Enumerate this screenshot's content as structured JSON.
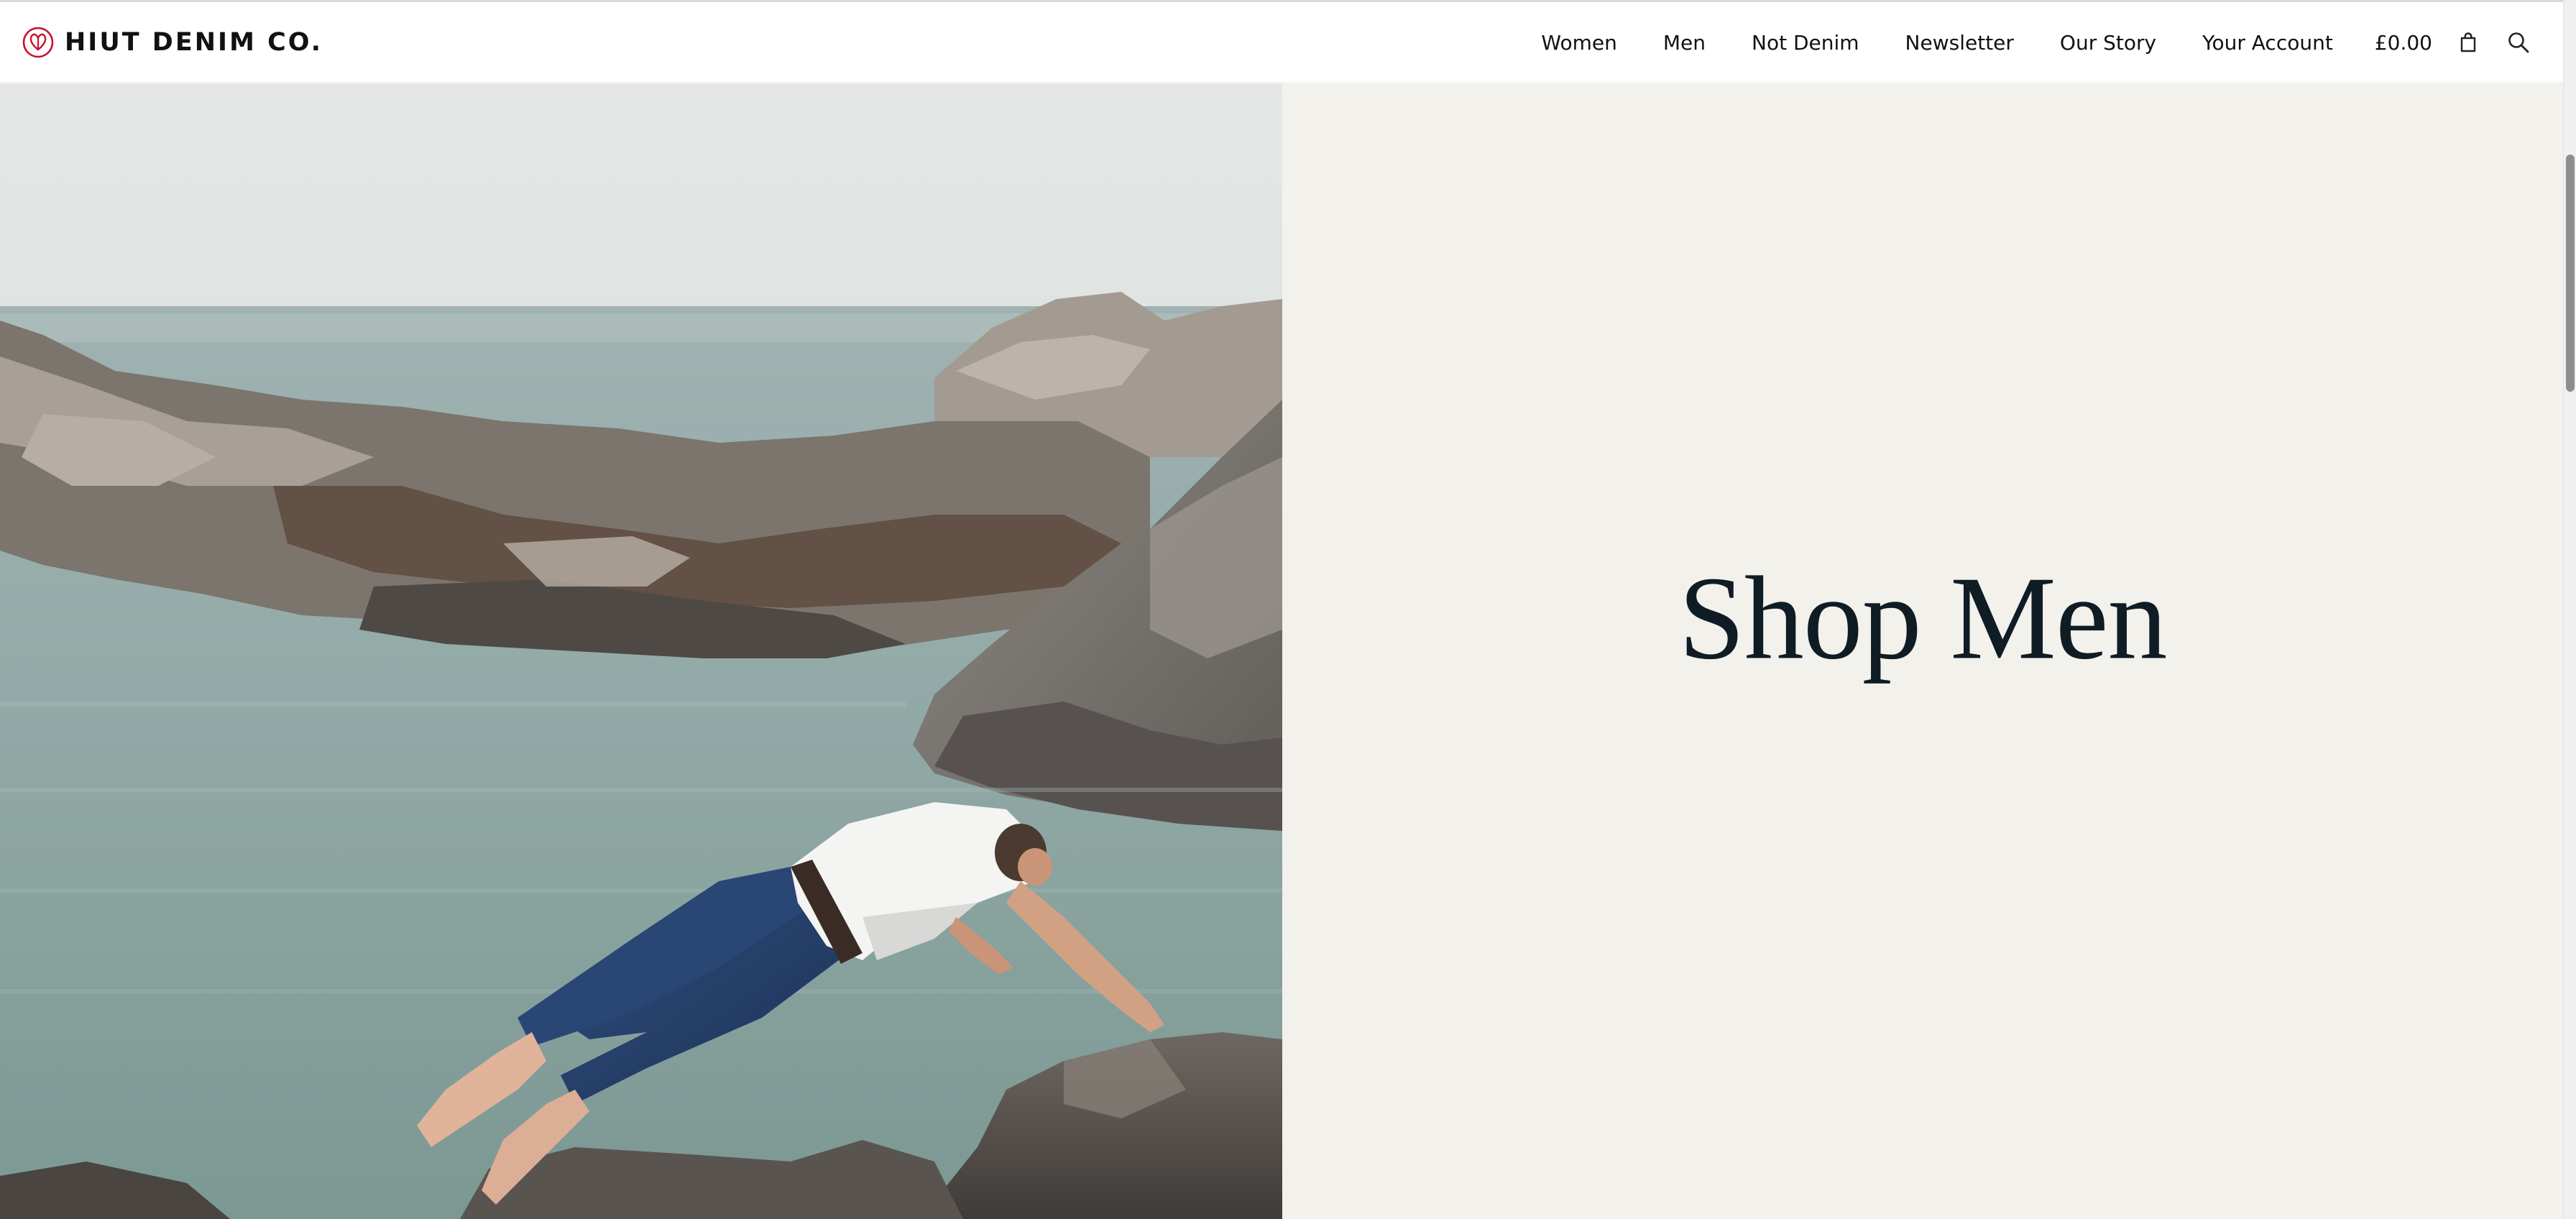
{
  "brand": {
    "name": "HIUT DENIM CO.",
    "accent_color": "#c8102e",
    "logo_icon": "leaf-heart-logo-icon"
  },
  "nav": {
    "items": [
      {
        "label": "Women"
      },
      {
        "label": "Men"
      },
      {
        "label": "Not Denim"
      },
      {
        "label": "Newsletter"
      },
      {
        "label": "Our Story"
      },
      {
        "label": "Your Account"
      }
    ],
    "cart_total": "£0.00",
    "cart_icon": "shopping-bag-icon",
    "search_icon": "search-icon"
  },
  "hero": {
    "title": "Shop Men",
    "image": "photo of man diving off rocks into sea wearing jeans and white t-shirt",
    "panel_color": "#f2f1ec",
    "title_color": "#0f1c24"
  }
}
